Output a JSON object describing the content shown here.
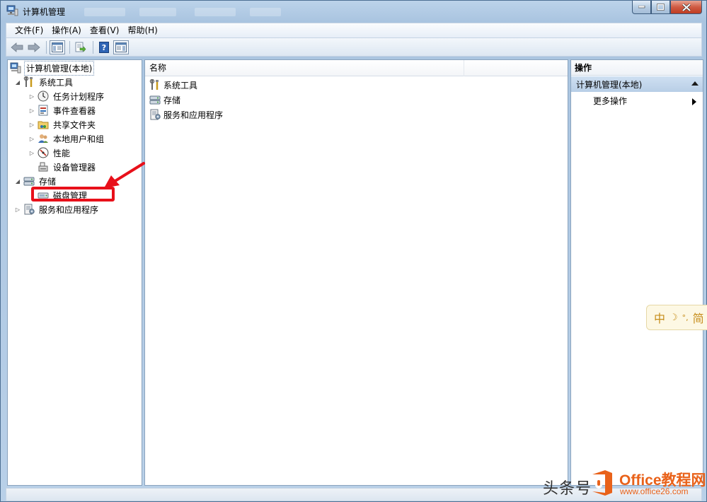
{
  "window": {
    "title": "计算机管理"
  },
  "menu": [
    "文件(F)",
    "操作(A)",
    "查看(V)",
    "帮助(H)"
  ],
  "tree": {
    "root": "计算机管理(本地)",
    "system_tools": "系统工具",
    "task_scheduler": "任务计划程序",
    "event_viewer": "事件查看器",
    "shared_folders": "共享文件夹",
    "local_users": "本地用户和组",
    "performance": "性能",
    "device_manager": "设备管理器",
    "storage": "存储",
    "disk_management": "磁盘管理",
    "services_apps": "服务和应用程序"
  },
  "list": {
    "column_name": "名称",
    "items": [
      "系统工具",
      "存储",
      "服务和应用程序"
    ]
  },
  "actions": {
    "header": "操作",
    "section": "计算机管理(本地)",
    "more": "更多操作"
  },
  "ime": {
    "mode": "中",
    "moon": "☽",
    "punct": "°,",
    "variant": "简"
  },
  "watermark": {
    "text": "头条号",
    "brand": "Office教程网",
    "url": "www.office26.com"
  },
  "colors": {
    "highlight": "#e8101a",
    "brand": "#e9621a",
    "selection": "#c9ddf1"
  }
}
